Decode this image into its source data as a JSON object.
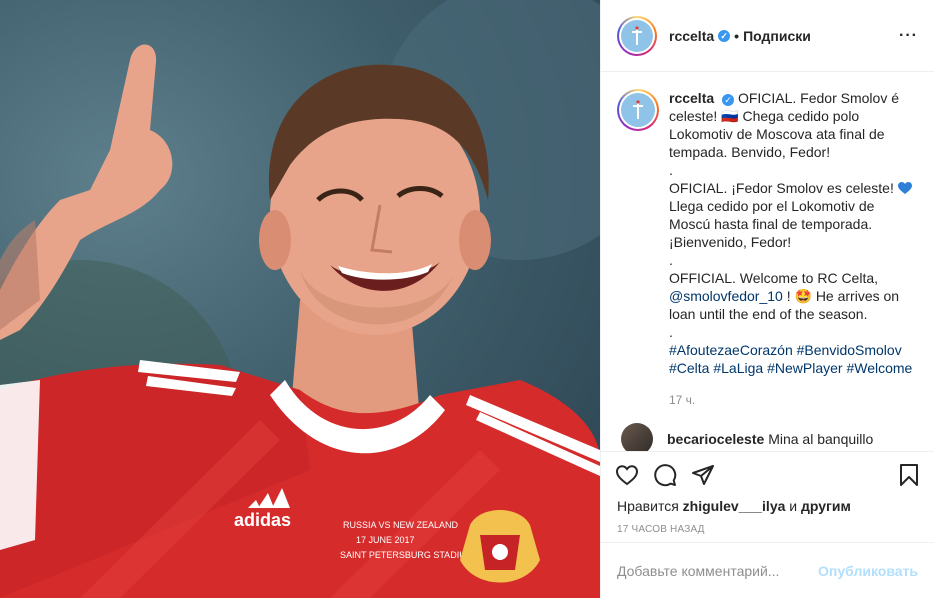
{
  "photo": {
    "alt_subject": "football player pointing up",
    "shirt_brand": "adidas",
    "shirt_text_line1": "RUSSIA VS NEW ZEALAND",
    "shirt_text_line2": "17 JUNE 2017",
    "shirt_text_line3": "SAINT PETERSBURG STADIUM"
  },
  "header": {
    "username": "rccelta",
    "verified_mark": "✓",
    "separator": "•",
    "follow_label": "Подписки",
    "more_label": "···"
  },
  "caption": {
    "username": "rccelta",
    "lines": [
      "OFICIAL. Fedor Smolov é celeste! 🇷🇺 Chega cedido polo Lokomotiv de Moscova ata final de tempada. Benvido, Fedor!",
      ".",
      "OFICIAL. ¡Fedor Smolov es celeste!",
      "Llega cedido por el Lokomotiv de Moscú hasta final de temporada. ¡Bienvenido, Fedor!",
      ".",
      "OFFICIAL. Welcome to RC Celta,",
      "@smolovfedor_10",
      "! 🤩 He arrives on loan until the end of the season.",
      ".",
      "#AfoutezaeCorazón #BenvidoSmolov #Celta #LaLiga #NewPlayer #Welcome"
    ],
    "time": "17 ч."
  },
  "comment": {
    "username": "becarioceleste",
    "text": "Mina al banquillo"
  },
  "likes": {
    "prefix": "Нравится",
    "user": "zhigulev___ilya",
    "suffix": "и",
    "others": "другим"
  },
  "post_time": "17 ЧАСОВ НАЗАД",
  "add_comment": {
    "placeholder": "Добавьте комментарий...",
    "publish_label": "Опубликовать"
  },
  "colors": {
    "link": "#00376b",
    "verified": "#3897f0",
    "publish_disabled": "#b2dffc",
    "jersey_red": "#d52b2b"
  }
}
